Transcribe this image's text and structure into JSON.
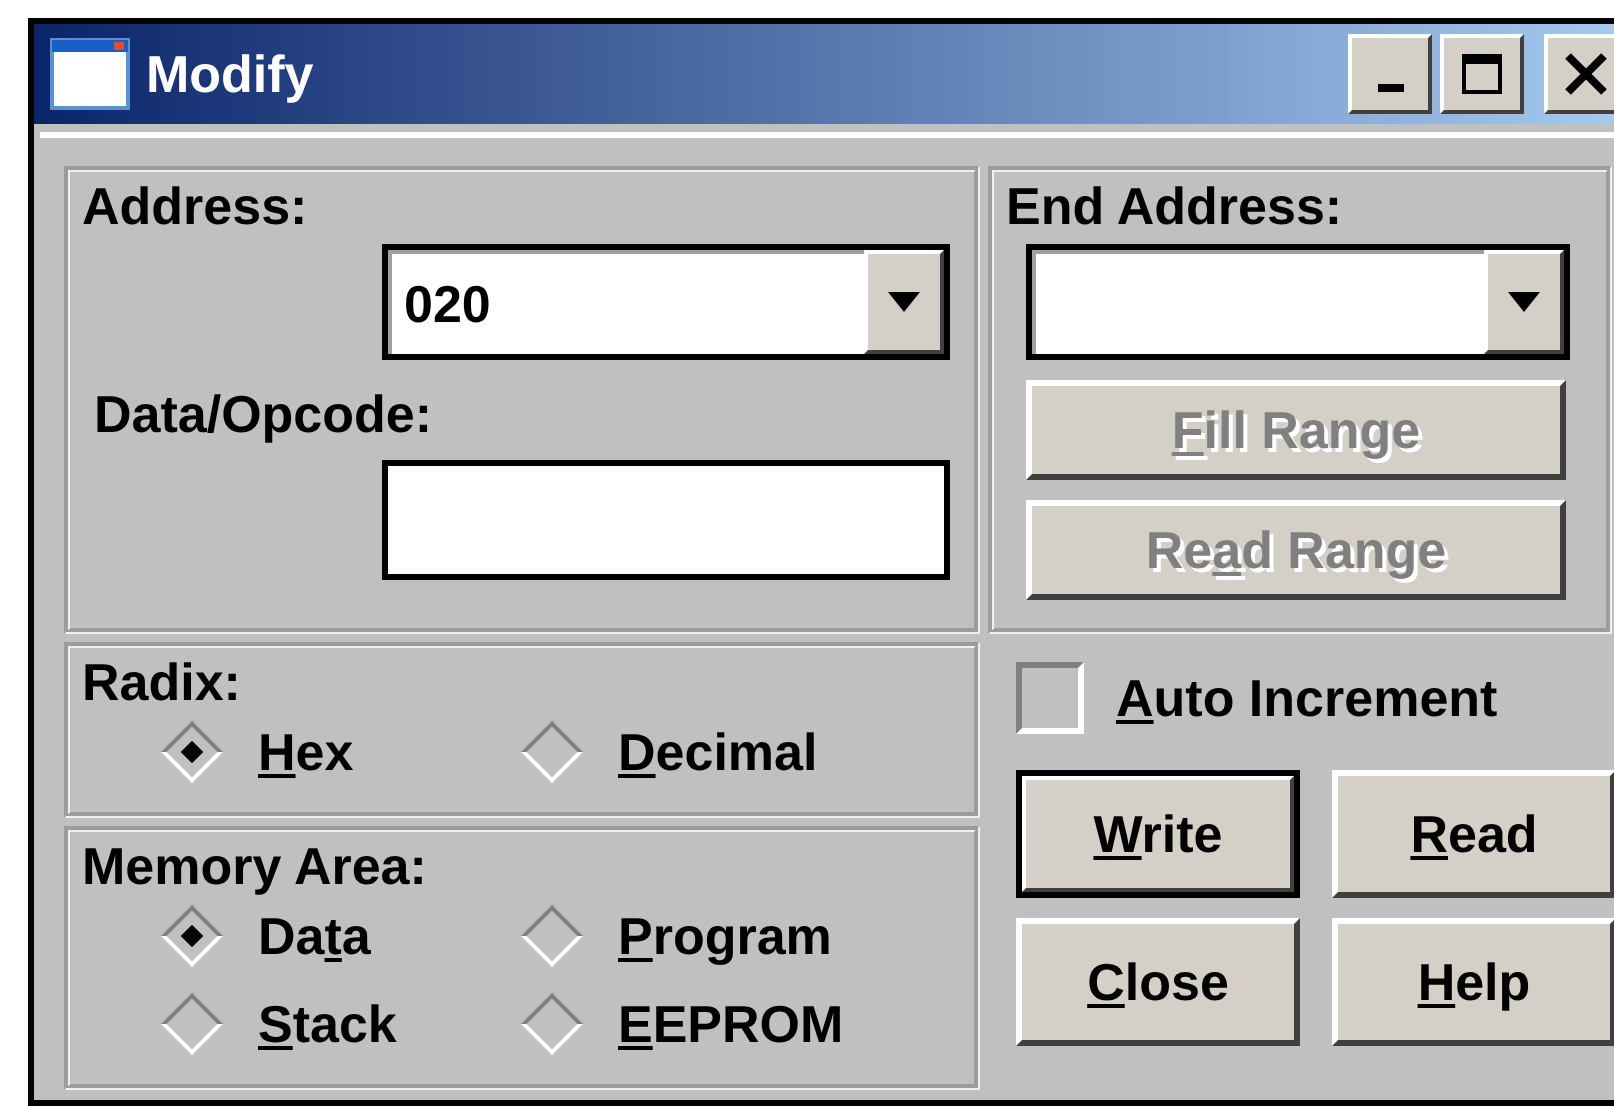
{
  "window": {
    "title": "Modify"
  },
  "address": {
    "label": "Address:",
    "value": "020"
  },
  "data_opcode": {
    "label": "Data/Opcode:"
  },
  "end_address": {
    "label": "End Address:"
  },
  "range_buttons": [
    {
      "key": "F",
      "post": "ill Range",
      "disabled": true
    },
    {
      "pre": "Re",
      "key": "a",
      "post": "d Range",
      "disabled": true
    }
  ],
  "radix": {
    "label": "Radix:",
    "options": [
      {
        "key": "H",
        "post": "ex",
        "selected": true
      },
      {
        "key": "D",
        "post": "ecimal",
        "selected": false
      }
    ]
  },
  "memory_area": {
    "label": "Memory Area:",
    "options": [
      {
        "pre": "Da",
        "key": "t",
        "post": "a",
        "selected": true
      },
      {
        "key": "P",
        "post": "rogram",
        "selected": false
      },
      {
        "key": "S",
        "post": "tack",
        "selected": false
      },
      {
        "key": "E",
        "post": "EPROM",
        "selected": false
      }
    ]
  },
  "auto_increment": {
    "key": "A",
    "post": "uto Increment",
    "checked": false
  },
  "buttons": [
    {
      "key": "W",
      "post": "rite",
      "default": true
    },
    {
      "key": "R",
      "post": "ead",
      "default": false
    },
    {
      "key": "C",
      "post": "lose",
      "default": false
    },
    {
      "key": "H",
      "post": "elp",
      "default": false
    }
  ]
}
